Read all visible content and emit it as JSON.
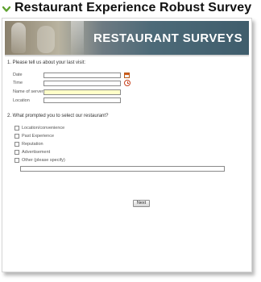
{
  "page": {
    "title": "Restaurant Experience Robust Survey",
    "accent_color": "#5ea12f",
    "chevron_icon": "chevron-down-icon"
  },
  "banner": {
    "title": "RESTAURANT SURVEYS"
  },
  "question1": {
    "text": "1.  Please tell us about your last visit:",
    "fields": [
      {
        "label": "Date",
        "value": "",
        "icon": "calendar-icon"
      },
      {
        "label": "Time",
        "value": "",
        "icon": "clock-icon"
      },
      {
        "label": "Name of server",
        "value": "",
        "icon": ""
      },
      {
        "label": "Location",
        "value": "",
        "icon": ""
      }
    ]
  },
  "question2": {
    "text": "2.  What prompted you to select our restaurant?",
    "options": [
      {
        "label": "Location/convenience",
        "checked": false
      },
      {
        "label": "Past Experience",
        "checked": false
      },
      {
        "label": "Reputation",
        "checked": false
      },
      {
        "label": "Advertisement",
        "checked": false
      },
      {
        "label": "Other (please specify)",
        "checked": false
      }
    ],
    "other_value": ""
  },
  "buttons": {
    "next_label": "Next"
  }
}
